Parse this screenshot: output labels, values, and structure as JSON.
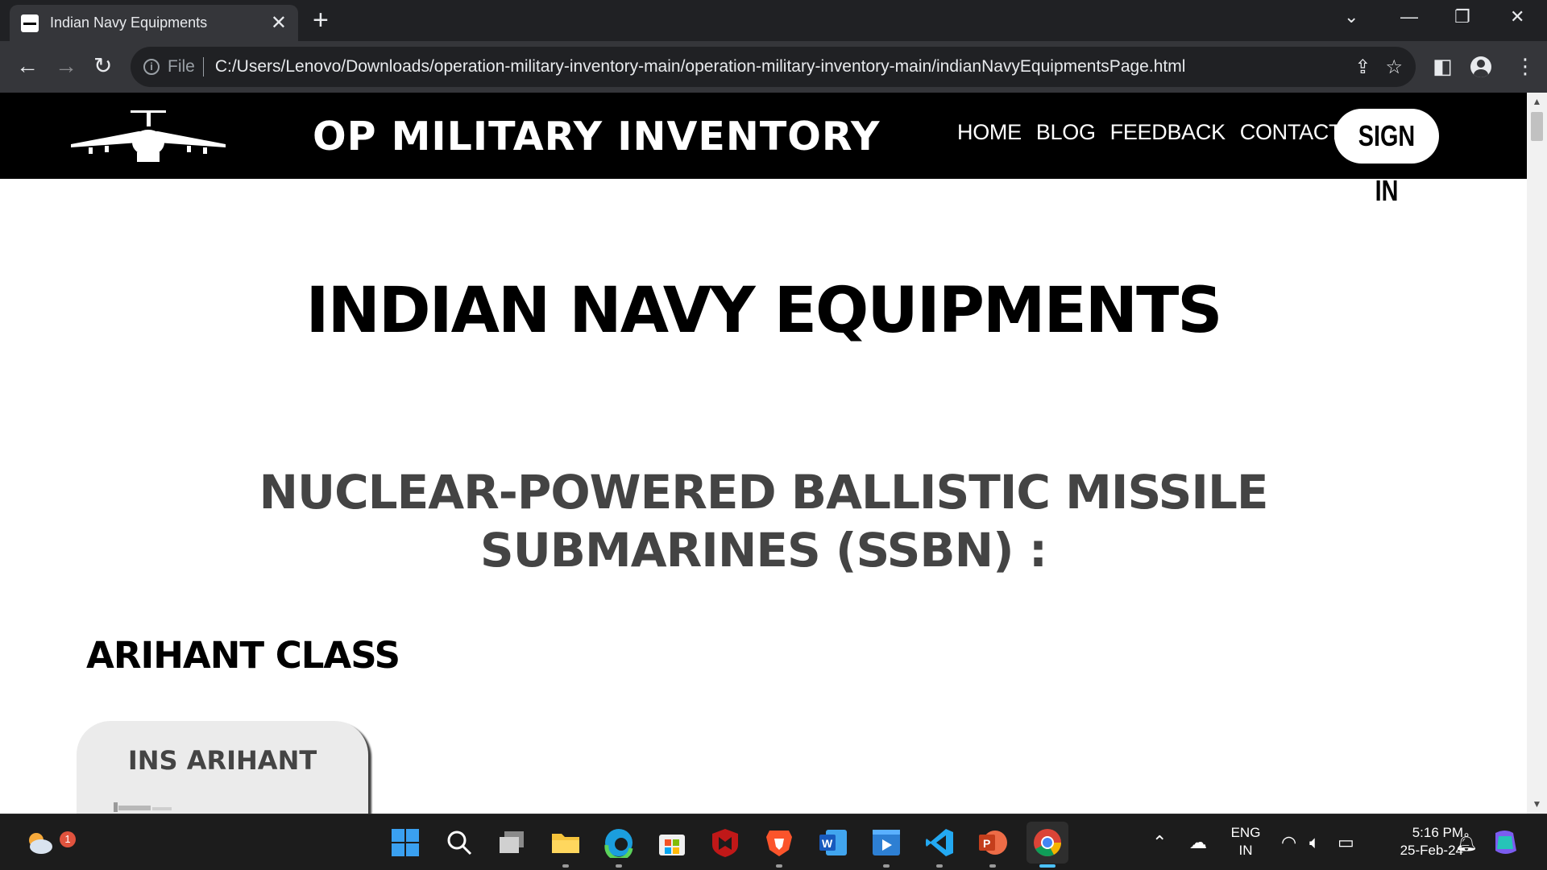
{
  "browser": {
    "tab_title": "Indian Navy Equipments",
    "address_prefix": "File",
    "url": "C:/Users/Lenovo/Downloads/operation-military-inventory-main/operation-military-inventory-main/indianNavyEquipmentsPage.html"
  },
  "site": {
    "brand": "OP MILITARY INVENTORY",
    "nav": [
      "HOME",
      "BLOG",
      "FEEDBACK",
      "CONTACT US"
    ],
    "signin": "SIGN IN"
  },
  "content": {
    "page_title": "INDIAN NAVY EQUIPMENTS",
    "section_title": "NUCLEAR-POWERED BALLISTIC MISSILE SUBMARINES (SSBN) :",
    "class_title": "ARIHANT CLASS",
    "card_title": "INS ARIHANT"
  },
  "taskbar": {
    "weather_badge": "1",
    "language": "ENG",
    "region": "IN",
    "time": "5:16 PM",
    "date": "25-Feb-24"
  },
  "colors": {
    "chrome_dark": "#202124",
    "chrome_toolbar": "#35363a",
    "site_header": "#000000",
    "section_text": "#444444",
    "card_bg": "#ebebeb",
    "active_indicator": "#4cc2ff"
  }
}
